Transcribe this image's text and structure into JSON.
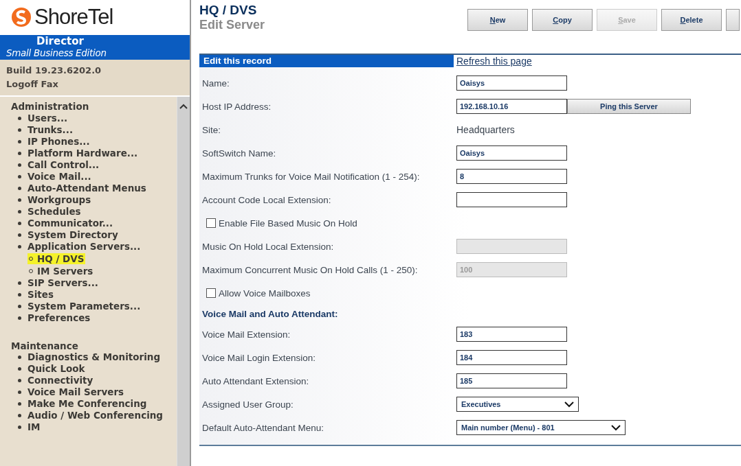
{
  "brand": {
    "logo": "ShoreTel",
    "product": "Director",
    "edition": "Small Business Edition"
  },
  "sidebar": {
    "build": "Build 19.23.6202.0",
    "logoff": "Logoff Fax",
    "sections": [
      {
        "title": "Administration",
        "items": [
          {
            "label": "Users...",
            "selected": false
          },
          {
            "label": "Trunks...",
            "selected": false
          },
          {
            "label": "IP Phones...",
            "selected": false
          },
          {
            "label": "Platform Hardware...",
            "selected": false
          },
          {
            "label": "Call Control...",
            "selected": false
          },
          {
            "label": "Voice Mail...",
            "selected": false
          },
          {
            "label": "Auto-Attendant Menus",
            "selected": false
          },
          {
            "label": "Workgroups",
            "selected": false
          },
          {
            "label": "Schedules",
            "selected": false
          },
          {
            "label": "Communicator...",
            "selected": false
          },
          {
            "label": "System Directory",
            "selected": false
          },
          {
            "label": "Application Servers...",
            "selected": false,
            "children": [
              {
                "label": "HQ / DVS",
                "selected": true
              },
              {
                "label": "IM Servers",
                "selected": false
              }
            ]
          },
          {
            "label": "SIP Servers...",
            "selected": false
          },
          {
            "label": "Sites",
            "selected": false
          },
          {
            "label": "System Parameters...",
            "selected": false
          },
          {
            "label": "Preferences",
            "selected": false
          }
        ]
      },
      {
        "title": "Maintenance",
        "items": [
          {
            "label": "Diagnostics & Monitoring",
            "selected": false
          },
          {
            "label": "Quick Look",
            "selected": false
          },
          {
            "label": "Connectivity",
            "selected": false
          },
          {
            "label": "Voice Mail Servers",
            "selected": false
          },
          {
            "label": "Make Me Conferencing",
            "selected": false
          },
          {
            "label": "Audio / Web Conferencing",
            "selected": false
          },
          {
            "label": "IM",
            "selected": false
          }
        ]
      }
    ]
  },
  "page": {
    "title": "HQ / DVS",
    "subtitle": "Edit Server"
  },
  "toolbar": [
    {
      "label": "New",
      "disabled": false
    },
    {
      "label": "Copy",
      "disabled": false
    },
    {
      "label": "Save",
      "disabled": true
    },
    {
      "label": "Delete",
      "disabled": false
    }
  ],
  "form": {
    "header": "Edit this record",
    "refresh_link": "Refresh this page",
    "rows": [
      {
        "kind": "text",
        "label": "Name:",
        "value": "Oaisys",
        "disabled": false
      },
      {
        "kind": "text_button",
        "label": "Host IP Address:",
        "value": "192.168.10.16",
        "button": "Ping this Server"
      },
      {
        "kind": "static",
        "label": "Site:",
        "value": "Headquarters"
      },
      {
        "kind": "text",
        "label": "SoftSwitch Name:",
        "value": "Oaisys",
        "disabled": false
      },
      {
        "kind": "text",
        "label": "Maximum Trunks for Voice Mail Notification (1 - 254):",
        "value": "8",
        "disabled": false
      },
      {
        "kind": "text",
        "label": "Account Code Local Extension:",
        "disabled": false
      },
      {
        "kind": "checkbox",
        "label": "Enable File Based Music On Hold",
        "checked": false
      },
      {
        "kind": "text",
        "label": "Music On Hold Local Extension:",
        "disabled": true
      },
      {
        "kind": "text",
        "label": "Maximum Concurrent Music On Hold Calls (1 - 250):",
        "value": "100",
        "disabled": true
      },
      {
        "kind": "checkbox",
        "label": "Allow Voice Mailboxes",
        "checked": false
      },
      {
        "kind": "heading",
        "label": "Voice Mail and Auto Attendant:"
      },
      {
        "kind": "text",
        "label": "Voice Mail Extension:",
        "value": "183",
        "disabled": false
      },
      {
        "kind": "text",
        "label": "Voice Mail Login Extension:",
        "value": "184",
        "disabled": false
      },
      {
        "kind": "text",
        "label": "Auto Attendant Extension:",
        "value": "185",
        "disabled": false
      },
      {
        "kind": "select",
        "label": "Assigned User Group:",
        "value": "Executives",
        "wide": false
      },
      {
        "kind": "select",
        "label": "Default Auto-Attendant Menu:",
        "value": "Main number (Menu) - 801",
        "wide": true
      }
    ]
  }
}
